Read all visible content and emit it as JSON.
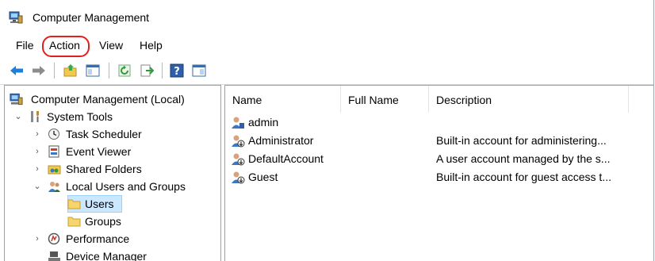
{
  "window": {
    "title": "Computer Management"
  },
  "menu": {
    "file": "File",
    "action": "Action",
    "view": "View",
    "help": "Help"
  },
  "toolbar": {
    "buttons": [
      "back-arrow-icon",
      "forward-arrow-icon",
      "up-folder-icon",
      "show-hide-tree-icon",
      "refresh-icon",
      "export-list-icon",
      "help-icon",
      "show-hide-action-pane-icon"
    ]
  },
  "tree": {
    "root": "Computer Management (Local)",
    "system_tools": "System Tools",
    "task_scheduler": "Task Scheduler",
    "event_viewer": "Event Viewer",
    "shared_folders": "Shared Folders",
    "local_users_groups": "Local Users and Groups",
    "users": "Users",
    "groups": "Groups",
    "performance": "Performance",
    "device_manager": "Device Manager"
  },
  "list": {
    "columns": {
      "name": "Name",
      "full_name": "Full Name",
      "description": "Description"
    },
    "rows": [
      {
        "name": "admin",
        "full_name": "",
        "description": ""
      },
      {
        "name": "Administrator",
        "full_name": "",
        "description": "Built-in account for administering..."
      },
      {
        "name": "DefaultAccount",
        "full_name": "",
        "description": "A user account managed by the s..."
      },
      {
        "name": "Guest",
        "full_name": "",
        "description": "Built-in account for guest access t..."
      }
    ]
  },
  "colors": {
    "highlight_ring": "#e1201e",
    "selection": "#cce8ff",
    "arrow_blue": "#1e7ed8"
  }
}
